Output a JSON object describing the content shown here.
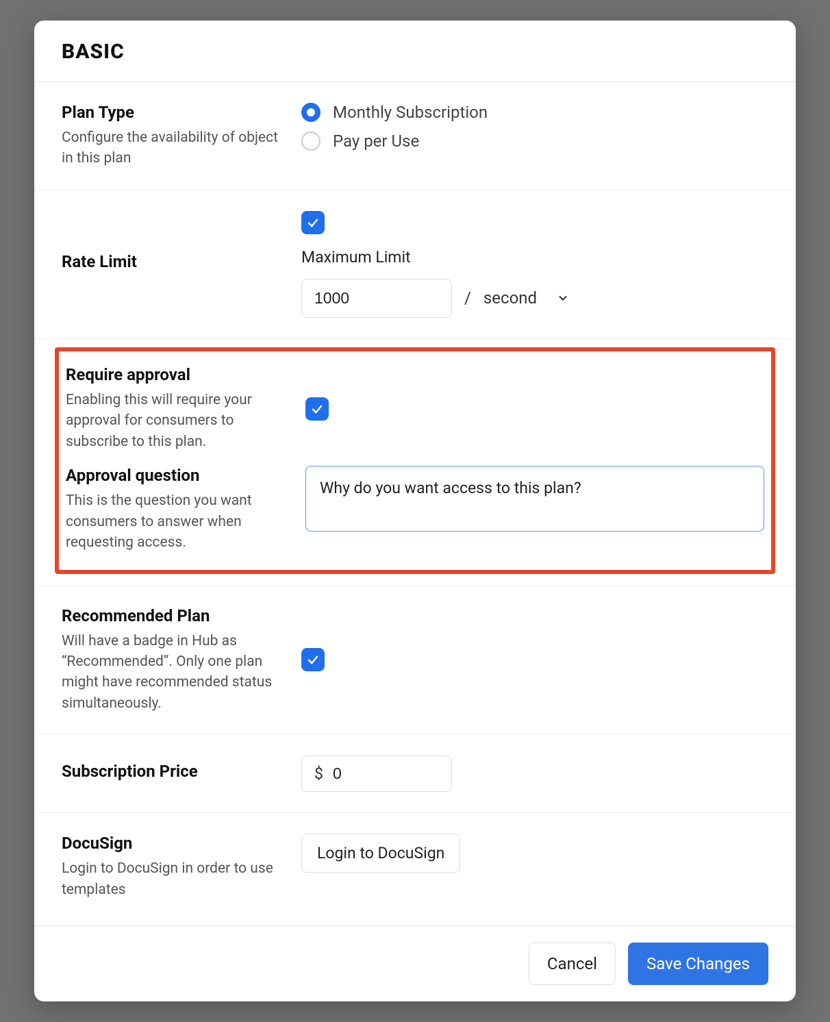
{
  "modal": {
    "title": "BASIC"
  },
  "planType": {
    "label": "Plan Type",
    "description": "Configure the availability of object in this plan",
    "options": {
      "monthly": "Monthly Subscription",
      "payPerUse": "Pay per Use"
    },
    "selected": "monthly"
  },
  "rateLimit": {
    "label": "Rate Limit",
    "maxLabel": "Maximum Limit",
    "value": "1000",
    "unitPrefix": "/",
    "unit": "second",
    "enabled": true
  },
  "requireApproval": {
    "label": "Require approval",
    "description": "Enabling this will require your approval for consumers to subscribe to this plan.",
    "enabled": true
  },
  "approvalQuestion": {
    "label": "Approval question",
    "description": "This is the question you want consumers to answer when requesting access.",
    "value": "Why do you want access to this plan?"
  },
  "recommended": {
    "label": "Recommended Plan",
    "description": "Will have a badge in Hub as “Recommended”. Only one plan might have recommended status simultaneously.",
    "enabled": true
  },
  "price": {
    "label": "Subscription Price",
    "currency": "$",
    "value": "0"
  },
  "docusign": {
    "label": "DocuSign",
    "description": "Login to DocuSign in order to use templates",
    "buttonLabel": "Login to DocuSign"
  },
  "footer": {
    "cancel": "Cancel",
    "save": "Save Changes"
  }
}
